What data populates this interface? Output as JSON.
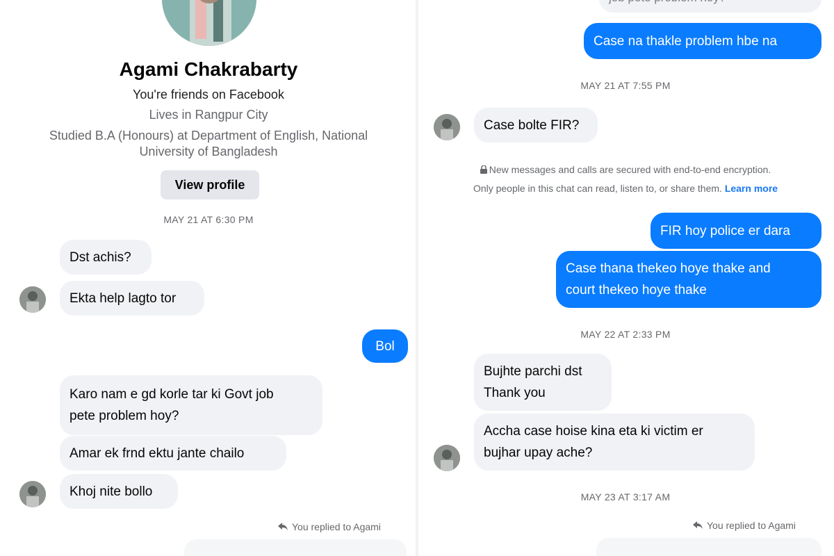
{
  "left": {
    "profile": {
      "name": "Agami Chakrabarty",
      "friends": "You're friends on Facebook",
      "lives": "Lives in Rangpur City",
      "studied": "Studied B.A (Honours) at Department of English, National\nUniversity of Bangladesh",
      "view_profile": "View profile"
    },
    "ts1": "MAY 21 AT 6:30 PM",
    "messages": [
      "Dst achis?",
      "Ekta help lagto tor",
      "Bol",
      "Karo nam e gd korle tar ki Govt job\npete problem hoy?",
      "Amar ek frnd ektu jante chailo",
      "Khoj nite bollo"
    ],
    "replied": "You replied to Agami"
  },
  "right": {
    "top_cut": "job pete problem hoy?",
    "messages": [
      "Case na thakle problem hbe na",
      "Case bolte FIR?",
      "FIR hoy police er dara",
      "Case thana thekeo hoye thake and\ncourt thekeo hoye thake",
      "Bujhte parchi dst\nThank you",
      "Accha case hoise kina eta ki victim er\nbujhar upay ache?"
    ],
    "ts1": "MAY 21 AT 7:55 PM",
    "ts2": "MAY 22 AT 2:33 PM",
    "ts3": "MAY 23 AT 3:17 AM",
    "notice_line1": "New messages and calls are secured with end-to-end encryption.",
    "notice_line2": "Only people in this chat can read, listen to, or share them.",
    "learn_more": "Learn more",
    "replied": "You replied to Agami"
  },
  "colors": {
    "outgoing": "#0a7cff",
    "incoming": "#f0f2f5",
    "link": "#1877f2"
  },
  "icons": [
    "lock-icon",
    "reply-icon",
    "avatar"
  ]
}
